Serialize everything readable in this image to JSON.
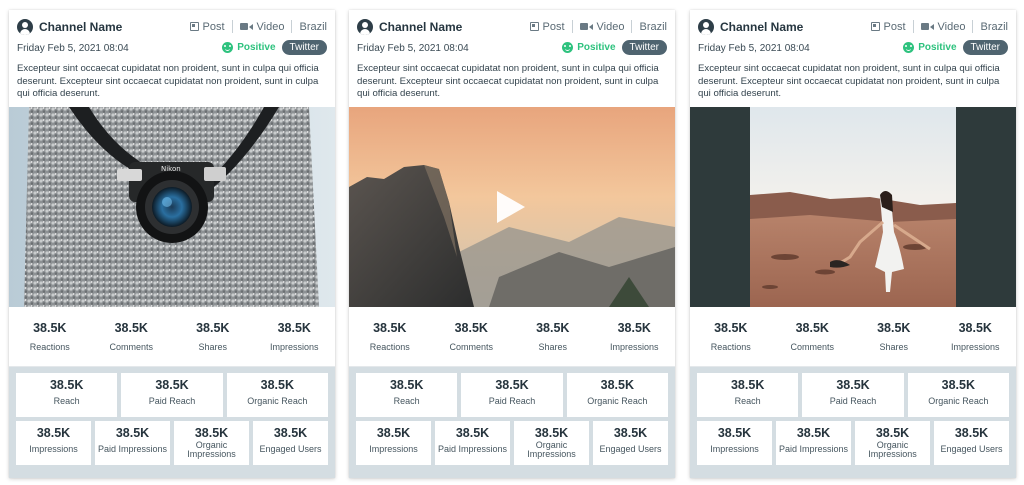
{
  "cards": [
    {
      "channel_name": "Channel Name",
      "post_label": "Post",
      "video_label": "Video",
      "country": "Brazil",
      "date": "Friday Feb 5, 2021 08:04",
      "sentiment": "Positive",
      "network": "Twitter",
      "description": "Excepteur sint occaecat cupidatat non proident, sunt in culpa qui officia deserunt. Excepteur sint occaecat cupidatat non proident, sunt in culpa qui officia deserunt.",
      "media": "photo-camera",
      "stats": [
        {
          "value": "38.5K",
          "label": "Reactions"
        },
        {
          "value": "38.5K",
          "label": "Comments"
        },
        {
          "value": "38.5K",
          "label": "Shares"
        },
        {
          "value": "38.5K",
          "label": "Impressions"
        }
      ],
      "metrics_top": [
        {
          "value": "38.5K",
          "label": "Reach"
        },
        {
          "value": "38.5K",
          "label": "Paid Reach"
        },
        {
          "value": "38.5K",
          "label": "Organic Reach"
        }
      ],
      "metrics_bottom": [
        {
          "value": "38.5K",
          "label": "Impressions"
        },
        {
          "value": "38.5K",
          "label": "Paid Impressions"
        },
        {
          "value": "38.5K",
          "label": "Organic Impressions"
        },
        {
          "value": "38.5K",
          "label": "Engaged Users"
        }
      ]
    },
    {
      "channel_name": "Channel Name",
      "post_label": "Post",
      "video_label": "Video",
      "country": "Brazil",
      "date": "Friday Feb 5, 2021 08:04",
      "sentiment": "Positive",
      "network": "Twitter",
      "description": "Excepteur sint occaecat cupidatat non proident, sunt in culpa qui officia deserunt. Excepteur sint occaecat cupidatat non proident, sunt in culpa qui officia deserunt.",
      "media": "video-mountain",
      "stats": [
        {
          "value": "38.5K",
          "label": "Reactions"
        },
        {
          "value": "38.5K",
          "label": "Comments"
        },
        {
          "value": "38.5K",
          "label": "Shares"
        },
        {
          "value": "38.5K",
          "label": "Impressions"
        }
      ],
      "metrics_top": [
        {
          "value": "38.5K",
          "label": "Reach"
        },
        {
          "value": "38.5K",
          "label": "Paid Reach"
        },
        {
          "value": "38.5K",
          "label": "Organic Reach"
        }
      ],
      "metrics_bottom": [
        {
          "value": "38.5K",
          "label": "Impressions"
        },
        {
          "value": "38.5K",
          "label": "Paid Impressions"
        },
        {
          "value": "38.5K",
          "label": "Organic Impressions"
        },
        {
          "value": "38.5K",
          "label": "Engaged Users"
        }
      ]
    },
    {
      "channel_name": "Channel Name",
      "post_label": "Post",
      "video_label": "Video",
      "country": "Brazil",
      "date": "Friday Feb 5, 2021 08:04",
      "sentiment": "Positive",
      "network": "Twitter",
      "description": "Excepteur sint occaecat cupidatat non proident, sunt in culpa qui officia deserunt. Excepteur sint occaecat cupidatat non proident, sunt in culpa qui officia deserunt.",
      "media": "photo-desert",
      "stats": [
        {
          "value": "38.5K",
          "label": "Reactions"
        },
        {
          "value": "38.5K",
          "label": "Comments"
        },
        {
          "value": "38.5K",
          "label": "Shares"
        },
        {
          "value": "38.5K",
          "label": "Impressions"
        }
      ],
      "metrics_top": [
        {
          "value": "38.5K",
          "label": "Reach"
        },
        {
          "value": "38.5K",
          "label": "Paid Reach"
        },
        {
          "value": "38.5K",
          "label": "Organic Reach"
        }
      ],
      "metrics_bottom": [
        {
          "value": "38.5K",
          "label": "Impressions"
        },
        {
          "value": "38.5K",
          "label": "Paid Impressions"
        },
        {
          "value": "38.5K",
          "label": "Organic Impressions"
        },
        {
          "value": "38.5K",
          "label": "Engaged Users"
        }
      ]
    }
  ],
  "colors": {
    "positive": "#2ec27e",
    "badge": "#4f6470",
    "metrics_panel": "#d4dde2"
  }
}
